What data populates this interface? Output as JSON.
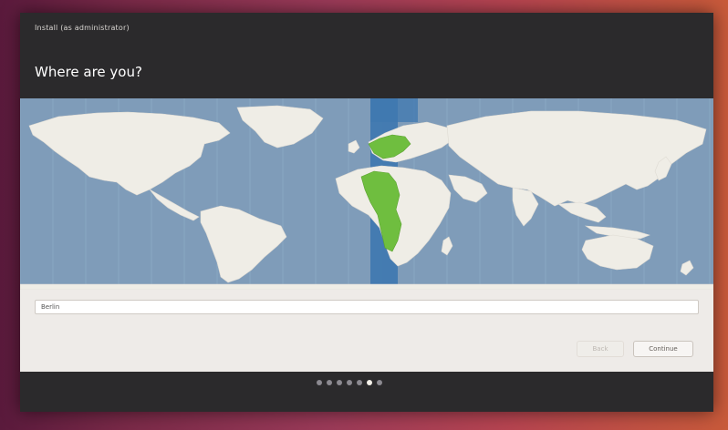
{
  "window": {
    "title": "Install (as administrator)"
  },
  "page": {
    "title": "Where are you?"
  },
  "timezone": {
    "value": "Berlin"
  },
  "buttons": {
    "back": "Back",
    "continue": "Continue"
  },
  "progress": {
    "steps": 7,
    "current": 6
  },
  "colors": {
    "ocean": "#7f9cb9",
    "land": "#efede6",
    "selected_zone": "#6fbe3f",
    "timezone_band": "#3f78b0"
  }
}
